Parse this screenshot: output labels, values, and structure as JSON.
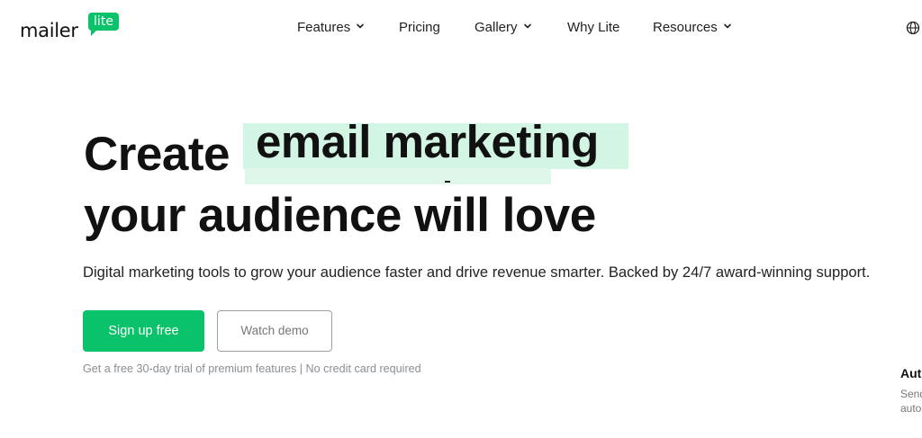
{
  "header": {
    "logo": {
      "wordmark": "mailer",
      "badge": "lite"
    },
    "nav": [
      {
        "label": "Features",
        "has_dropdown": true
      },
      {
        "label": "Pricing",
        "has_dropdown": false
      },
      {
        "label": "Gallery",
        "has_dropdown": true
      },
      {
        "label": "Why Lite",
        "has_dropdown": false
      },
      {
        "label": "Resources",
        "has_dropdown": true
      }
    ],
    "language_icon": "globe-icon"
  },
  "hero": {
    "title_prefix": "Create",
    "title_highlight": "email marketing",
    "title_line2": "your audience will love",
    "subtitle": "Digital marketing tools to grow your audience faster and drive revenue smarter. Backed by 24/7 award-winning support.",
    "primary_cta": "Sign up free",
    "secondary_cta": "Watch demo",
    "note": "Get a free 30-day trial of premium features | No credit card required"
  },
  "side_card": {
    "title": "Aut",
    "lines": [
      "Send",
      "auto"
    ]
  },
  "colors": {
    "brand": "#09c269",
    "highlight": "#d3f5e4",
    "text": "#111111",
    "muted": "#8a8f94"
  }
}
